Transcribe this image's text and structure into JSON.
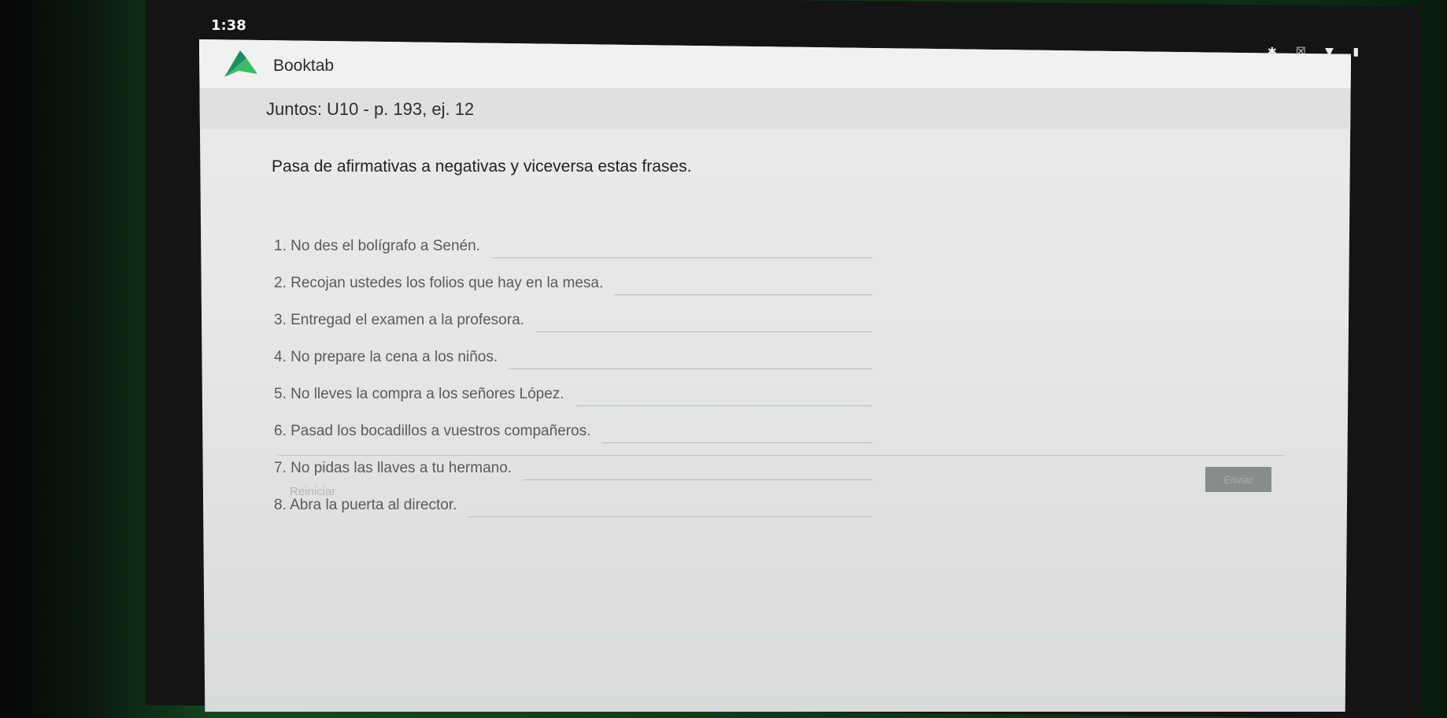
{
  "status_bar": {
    "time": "1:38",
    "icons": [
      "bluetooth-icon",
      "mute-icon",
      "wifi-icon",
      "battery-icon"
    ],
    "icons_text": "✱ ☒ ▼ ▮"
  },
  "app": {
    "name": "Booktab",
    "logo_colors": [
      "#1c8f5e",
      "#2a5fa8",
      "#3dbb6b"
    ]
  },
  "exercise": {
    "title": "Juntos: U10 - p. 193, ej. 12",
    "instruction": "Pasa de afirmativas a negativas y viceversa estas frases.",
    "items": [
      {
        "text": "1. No des el bolígrafo a Senén.",
        "answer": ""
      },
      {
        "text": "2. Recojan ustedes los folios que hay en la mesa.",
        "answer": ""
      },
      {
        "text": "3. Entregad el examen a la profesora.",
        "answer": ""
      },
      {
        "text": "4. No prepare la cena a los niños.",
        "answer": ""
      },
      {
        "text": "5. No lleves la compra a los señores López.",
        "answer": ""
      },
      {
        "text": "6. Pasad los bocadillos a vuestros compañeros.",
        "answer": ""
      },
      {
        "text": "7. No pidas las llaves a tu hermano.",
        "answer": ""
      },
      {
        "text": "8. Abra la puerta al director.",
        "answer": ""
      }
    ]
  },
  "actions": {
    "reset_label": "Reiniciar",
    "submit_label": "Enviar"
  }
}
